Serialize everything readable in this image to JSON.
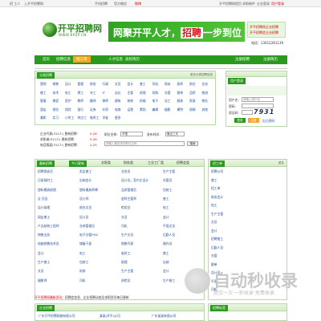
{
  "topbar": {
    "left_links": [
      "招 工人",
      "上开平招聘网"
    ],
    "mobile_link": "手机招聘",
    "wechat_link": "官方微信",
    "weibo_link": "微博",
    "right_links": [
      "开平招聘网首页",
      "求职邮件",
      "企业登录"
    ],
    "register": "用户登录"
  },
  "logo": {
    "name": "开平招聘网",
    "sub": "WWW.KPZP.CN"
  },
  "banner": {
    "text_a": "网聚开平人才，",
    "text_b": "招聘",
    "text_c": "一步到位"
  },
  "side_ad": {
    "line1": "开平招聘网企业招聘",
    "line2": "开平招聘会企业招聘"
  },
  "phone": {
    "label": "电话：",
    "number": "13612281139"
  },
  "nav": {
    "items": [
      "首页",
      "招聘信息",
      "招工单",
      "人才信息",
      "高校简历"
    ],
    "right_btn_1": "注册招聘",
    "right_btn_2": "注册简历"
  },
  "categories": {
    "title": "分类招聘",
    "more": "更多分类招聘信息",
    "items": [
      [
        "营销",
        "销售",
        "设计",
        "管理",
        "财务",
        "行政",
        "文员",
        "会计",
        "普工",
        "司机",
        "保安",
        "厨师",
        "前台",
        "业务"
      ],
      [
        "普工",
        "技术",
        "电工",
        "焊工",
        "车工",
        "IT",
        "店长",
        "主管",
        "经理",
        "导购",
        "仓管",
        "跟单",
        "品检",
        "物流"
      ],
      [
        "客服",
        "美容",
        "医护",
        "教师",
        "翻译",
        "律师",
        "建筑",
        "装修",
        "机械",
        "电子",
        "化工",
        "服装",
        "家具",
        "物业"
      ],
      [
        "酒店",
        "餐饮",
        "保险",
        "银行",
        "证券",
        "外贸",
        "电商",
        "运营",
        "策划",
        "编辑",
        "摄影",
        "模特",
        "保姆",
        "其他"
      ],
      [
        "兼职",
        "实习",
        "小时工",
        "钟点工",
        "临时工",
        "学徒",
        "更多"
      ]
    ]
  },
  "login": {
    "title": "用户登录",
    "user_label": "用户名：",
    "user_placeholder": "请输入用户名",
    "pass_label": "密码：",
    "code_label": "验证码：",
    "captcha": "7931",
    "login_btn": "登录",
    "reg_btn": "注册",
    "forgot": "忘记密码"
  },
  "stats": [
    {
      "label": "企业代表(311人) 更新招聘：",
      "value": "5-26"
    },
    {
      "label": "求职者(311人) 更新招聘：",
      "value": "5-26"
    },
    {
      "label": "电话版面(311人) 更新招聘：",
      "value": "2-25"
    }
  ],
  "search": {
    "field_label": "职位名称：",
    "field_value": "不限",
    "time_label": "发布时间：",
    "time_value": "最近三天",
    "keyword_placeholder": "请输入要查找的职位名称",
    "button": "搜索"
  },
  "jobs": {
    "title": "最新招聘",
    "tabs": [
      "今日更新",
      "文职类",
      "财务类",
      "工业工厂类",
      "招聘会类"
    ],
    "more": "更多招聘",
    "rows": [
      [
        "招聘保安员",
        "男女普工",
        "业务员",
        "生产主管"
      ],
      [
        "日班临时工",
        "出纳会计",
        "设计员，室内主设计",
        "仓管员"
      ],
      [
        "塑料模具经理",
        "塑料模具师傅",
        "品质管理员",
        "包装工"
      ],
      [
        "全 员员",
        "设计师",
        "厨师主管师",
        "普工"
      ],
      [
        "设计助理",
        "前台文员",
        "检验员",
        "电工"
      ],
      [
        "网店美工",
        "设计员",
        "文员",
        "会计"
      ],
      [
        "产品结构工程师",
        "仓库管理员",
        "司机",
        "平面文员"
      ],
      [
        "销售业务",
        "电子仓管PMC",
        "生产文员",
        "后勤人员"
      ],
      [
        "电脑销售技术员",
        "储备干部",
        "销售代表",
        "操作员"
      ],
      [
        "会计",
        "电工",
        "临时工",
        "普工"
      ],
      [
        "生产普工",
        "包装工",
        "助理",
        "出纳"
      ],
      [
        "文员",
        "机修",
        "生产主管",
        "会计"
      ],
      [
        "摄影师",
        "司机",
        "质检员",
        "生产普工"
      ]
    ]
  },
  "right_panel": {
    "title": "招工单",
    "more": "更多",
    "items": [
      "招聘公司",
      "普工",
      "招工单",
      "财务会计",
      "电工",
      "生产主管",
      "文员",
      "会计",
      "招聘普工",
      "后勤人员",
      "仓管",
      "跟单",
      "设计员",
      "平面",
      "司机"
    ]
  },
  "bottom": {
    "notice_prefix": "开平招聘网最新资讯：",
    "notice_text": "招聘会信息、企业招聘动态及求职资讯每日更新",
    "company_title": "企业招聘",
    "company_item": "广东开平招聘网络有限公司",
    "company_item2": "某某(开平)公司",
    "company_item3": "广东某某有限公司",
    "right_title": "招聘标签"
  },
  "watermark": {
    "text": "自动秒收录",
    "sub": "提交一次·一秒收录·免费收录"
  },
  "colors": {
    "brand_green": "#2a9a1e",
    "accent_orange": "#f5a623",
    "alert_red": "#d00000"
  }
}
